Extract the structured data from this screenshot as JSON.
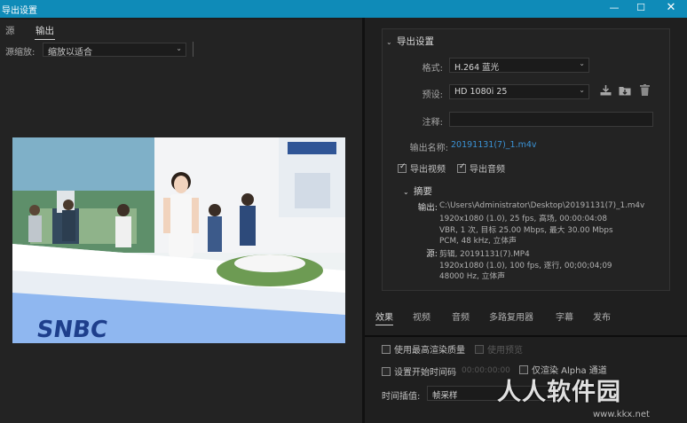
{
  "window": {
    "title": "导出设置",
    "min_glyph": "—",
    "max_glyph": "☐",
    "close_glyph": "✕"
  },
  "source_panel": {
    "tabs": [
      "源",
      "输出"
    ],
    "active_tab": "输出",
    "scale_label": "源缩放:",
    "scale_value": "缩放以适合",
    "preview_image": {
      "signage_text": "SNBC"
    }
  },
  "export_settings": {
    "section_title": "导出设置",
    "format_label": "格式:",
    "format_value": "H.264 蓝光",
    "preset_label": "预设:",
    "preset_value": "HD 1080i 25",
    "comment_label": "注释:",
    "comment_value": "",
    "output_name_label": "输出名称:",
    "output_name_value": "20191131(7)_1.m4v",
    "export_video_label": "导出视频",
    "export_video_checked": true,
    "export_audio_label": "导出音频",
    "export_audio_checked": true,
    "icons": [
      "save-preset-icon",
      "import-preset-icon",
      "delete-preset-icon"
    ]
  },
  "summary": {
    "title": "摘要",
    "output_label": "输出:",
    "output_lines": [
      "C:\\Users\\Administrator\\Desktop\\20191131(7)_1.m4v",
      "1920x1080 (1.0), 25 fps, 高场, 00:00:04:08",
      "VBR, 1 次, 目标 25.00 Mbps, 最大 30.00 Mbps",
      "PCM, 48 kHz, 立体声"
    ],
    "source_label": "源:",
    "source_lines": [
      "剪辑, 20191131(7).MP4",
      "1920x1080 (1.0), 100 fps, 逐行, 00;00;04;09",
      "48000 Hz, 立体声"
    ]
  },
  "bottom_tabs": [
    "效果",
    "视频",
    "音频",
    "多路复用器",
    "字幕",
    "发布"
  ],
  "bottom_active_tab": "效果",
  "options": {
    "max_render_quality": "使用最高渲染质量",
    "use_previews": "使用预览",
    "set_start_timecode": "设置开始时间码",
    "start_timecode_value": "00:00:00:00",
    "render_alpha_only": "仅渲染 Alpha 通道",
    "time_interp_label": "时间插值:",
    "time_interp_value": "帧采样"
  },
  "watermark": {
    "main": "人人软件园",
    "sub": "www.kkx.net"
  }
}
